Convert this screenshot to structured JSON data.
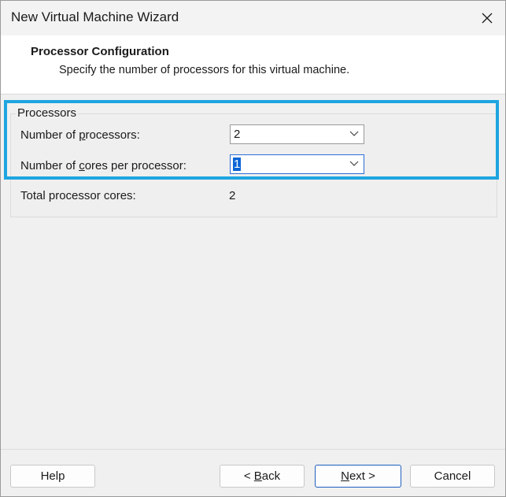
{
  "window": {
    "title": "New Virtual Machine Wizard",
    "close_icon": "close-icon"
  },
  "header": {
    "title": "Processor Configuration",
    "subtitle": "Specify the number of processors for this virtual machine."
  },
  "processors_group": {
    "label": "Processors",
    "num_processors": {
      "label_pre": "Number of ",
      "label_mnemonic": "p",
      "label_post": "rocessors:",
      "value": "2"
    },
    "cores_per_processor": {
      "label_pre": "Number of ",
      "label_mnemonic": "c",
      "label_post": "ores per processor:",
      "value": "1"
    },
    "total_cores": {
      "label": "Total processor cores:",
      "value": "2"
    }
  },
  "buttons": {
    "help": "Help",
    "back": {
      "prefix": "< ",
      "mnemonic": "B",
      "rest": "ack"
    },
    "next": {
      "mnemonic": "N",
      "rest": "ext >"
    },
    "cancel": "Cancel"
  },
  "colors": {
    "highlight": "#1ea5e0",
    "selection": "#0a64d6"
  }
}
